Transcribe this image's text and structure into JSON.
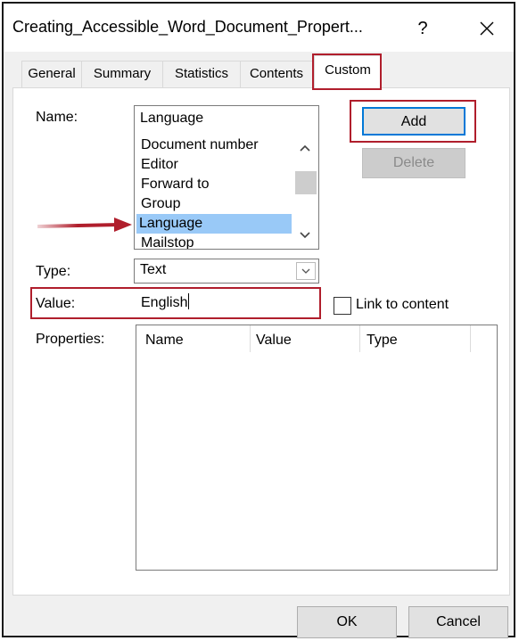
{
  "window": {
    "title": "Creating_Accessible_Word_Document_Propert...",
    "help_label": "?"
  },
  "tabs": [
    {
      "label": "General"
    },
    {
      "label": "Summary"
    },
    {
      "label": "Statistics"
    },
    {
      "label": "Contents"
    },
    {
      "label": "Custom"
    }
  ],
  "active_tab": "Custom",
  "form": {
    "name_label": "Name:",
    "name_value": "Language",
    "name_options": [
      "Document number",
      "Editor",
      "Forward to",
      "Group",
      "Language",
      "Mailstop"
    ],
    "name_selected": "Language",
    "type_label": "Type:",
    "type_value": "Text",
    "value_label": "Value:",
    "value_value": "English",
    "link_label": "Link to content",
    "link_checked": false,
    "properties_label": "Properties:"
  },
  "buttons": {
    "add": "Add",
    "delete": "Delete",
    "ok": "OK",
    "cancel": "Cancel"
  },
  "properties_table": {
    "columns": [
      "Name",
      "Value",
      "Type"
    ],
    "rows": []
  },
  "colors": {
    "highlight_red": "#b01e2c",
    "selection_blue": "#99c9f7",
    "accent_blue": "#0078d7"
  }
}
